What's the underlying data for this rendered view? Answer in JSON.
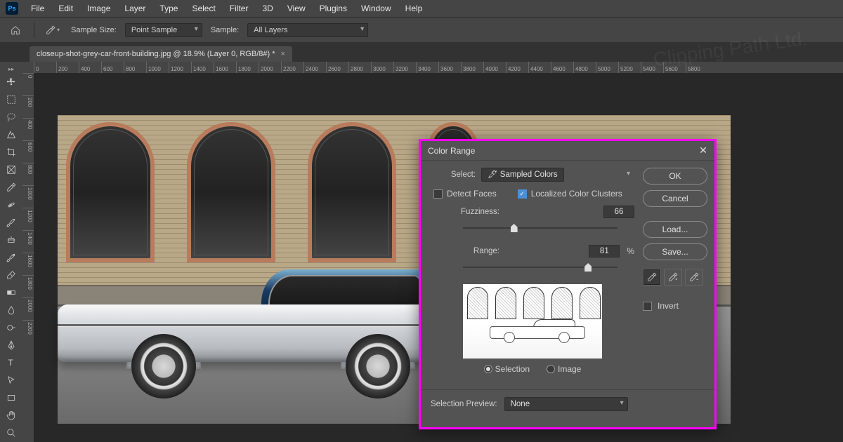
{
  "app": {
    "ps_label": "Ps"
  },
  "menubar": [
    "File",
    "Edit",
    "Image",
    "Layer",
    "Type",
    "Select",
    "Filter",
    "3D",
    "View",
    "Plugins",
    "Window",
    "Help"
  ],
  "optbar": {
    "sample_size_label": "Sample Size:",
    "sample_size_value": "Point Sample",
    "sample_label": "Sample:",
    "sample_value": "All Layers"
  },
  "doc_tab": {
    "title": "closeup-shot-grey-car-front-building.jpg @ 18.9% (Layer 0, RGB/8#) *",
    "close": "×"
  },
  "ruler_h": [
    "0",
    "200",
    "400",
    "600",
    "800",
    "1000",
    "1200",
    "1400",
    "1600",
    "1800",
    "2000",
    "2200",
    "2400",
    "2600",
    "2800",
    "3000",
    "3200",
    "3400",
    "3600",
    "3800",
    "4000",
    "4200",
    "4400",
    "4600",
    "4800",
    "5000",
    "5200",
    "5400",
    "5600",
    "5800"
  ],
  "ruler_v": [
    "0",
    "200",
    "400",
    "600",
    "800",
    "1000",
    "1200",
    "1400",
    "1600",
    "1800",
    "2000",
    "2200"
  ],
  "dialog": {
    "title": "Color Range",
    "select_label": "Select:",
    "select_value": "Sampled Colors",
    "detect_faces": "Detect Faces",
    "localized": "Localized Color Clusters",
    "fuzziness_label": "Fuzziness:",
    "fuzziness_value": "66",
    "range_label": "Range:",
    "range_value": "81",
    "range_unit": "%",
    "radio_selection": "Selection",
    "radio_image": "Image",
    "selection_preview_label": "Selection Preview:",
    "selection_preview_value": "None",
    "btn_ok": "OK",
    "btn_cancel": "Cancel",
    "btn_load": "Load...",
    "btn_save": "Save...",
    "invert": "Invert"
  },
  "watermark": "Clipping Path Ltd."
}
